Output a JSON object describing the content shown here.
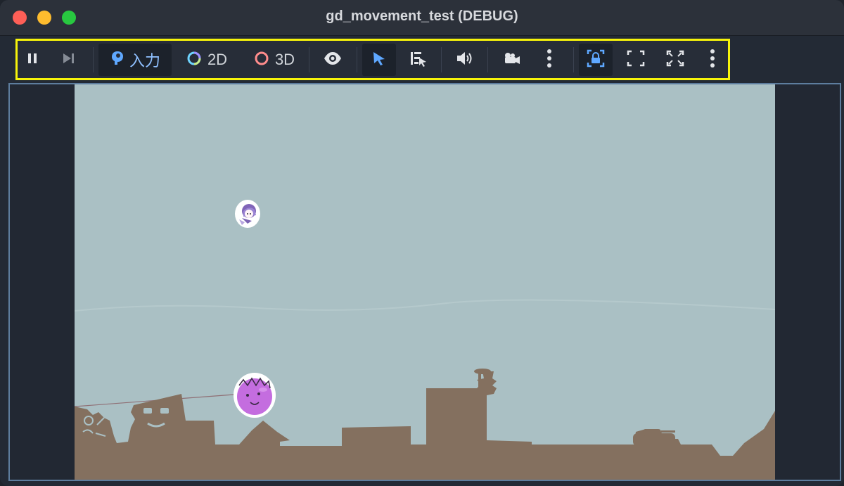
{
  "window": {
    "title": "gd_movement_test (DEBUG)"
  },
  "toolbar": {
    "input_label": "入力",
    "mode_2d_label": "2D",
    "mode_3d_label": "3D",
    "buttons": [
      {
        "icon": "pause-icon"
      },
      {
        "icon": "step-forward-icon"
      },
      {
        "icon": "input-icon"
      },
      {
        "icon": "2d-icon"
      },
      {
        "icon": "3d-icon"
      },
      {
        "icon": "eye-icon"
      },
      {
        "icon": "select-arrow-icon"
      },
      {
        "icon": "list-select-icon"
      },
      {
        "icon": "speaker-icon"
      },
      {
        "icon": "camera-icon"
      },
      {
        "icon": "kebab-menu-icon"
      },
      {
        "icon": "lock-frame-icon"
      },
      {
        "icon": "fullscreen-icon"
      },
      {
        "icon": "fullscreen-expand-icon"
      },
      {
        "icon": "kebab-menu-icon"
      }
    ]
  },
  "colors": {
    "toolbar_highlight": "#f7f40a",
    "active_blue": "#5fa8ff",
    "sky": "#aac0c4",
    "ground": "#84705f",
    "slime": "#c46ddf"
  }
}
